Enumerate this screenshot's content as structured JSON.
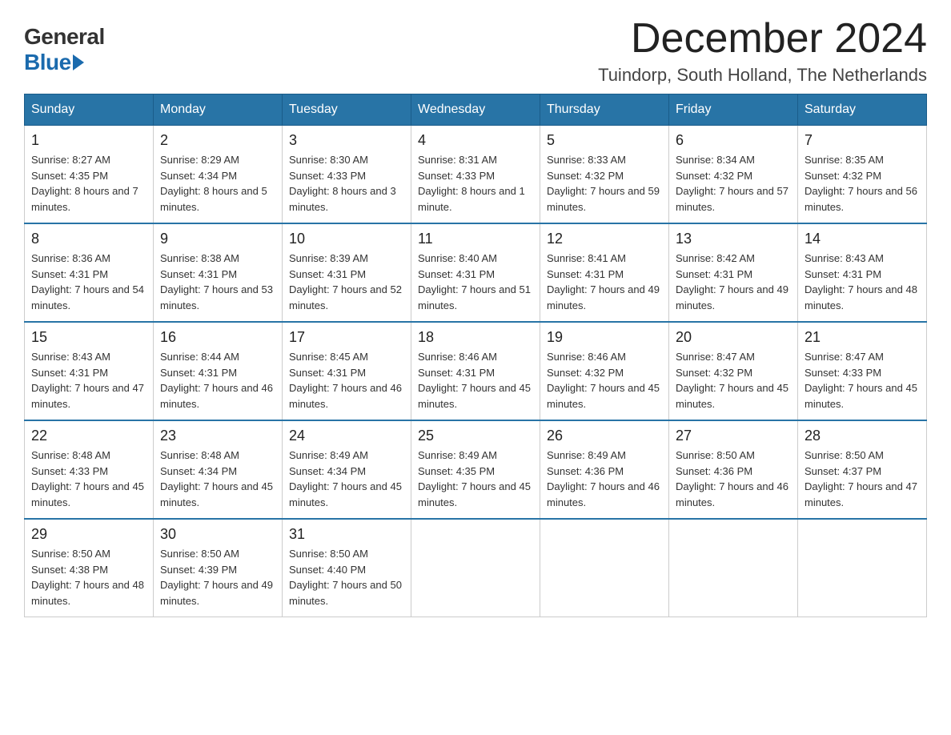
{
  "logo": {
    "general": "General",
    "blue": "Blue"
  },
  "header": {
    "month_year": "December 2024",
    "location": "Tuindorp, South Holland, The Netherlands"
  },
  "weekdays": [
    "Sunday",
    "Monday",
    "Tuesday",
    "Wednesday",
    "Thursday",
    "Friday",
    "Saturday"
  ],
  "weeks": [
    [
      {
        "day": "1",
        "sunrise": "8:27 AM",
        "sunset": "4:35 PM",
        "daylight": "8 hours and 7 minutes."
      },
      {
        "day": "2",
        "sunrise": "8:29 AM",
        "sunset": "4:34 PM",
        "daylight": "8 hours and 5 minutes."
      },
      {
        "day": "3",
        "sunrise": "8:30 AM",
        "sunset": "4:33 PM",
        "daylight": "8 hours and 3 minutes."
      },
      {
        "day": "4",
        "sunrise": "8:31 AM",
        "sunset": "4:33 PM",
        "daylight": "8 hours and 1 minute."
      },
      {
        "day": "5",
        "sunrise": "8:33 AM",
        "sunset": "4:32 PM",
        "daylight": "7 hours and 59 minutes."
      },
      {
        "day": "6",
        "sunrise": "8:34 AM",
        "sunset": "4:32 PM",
        "daylight": "7 hours and 57 minutes."
      },
      {
        "day": "7",
        "sunrise": "8:35 AM",
        "sunset": "4:32 PM",
        "daylight": "7 hours and 56 minutes."
      }
    ],
    [
      {
        "day": "8",
        "sunrise": "8:36 AM",
        "sunset": "4:31 PM",
        "daylight": "7 hours and 54 minutes."
      },
      {
        "day": "9",
        "sunrise": "8:38 AM",
        "sunset": "4:31 PM",
        "daylight": "7 hours and 53 minutes."
      },
      {
        "day": "10",
        "sunrise": "8:39 AM",
        "sunset": "4:31 PM",
        "daylight": "7 hours and 52 minutes."
      },
      {
        "day": "11",
        "sunrise": "8:40 AM",
        "sunset": "4:31 PM",
        "daylight": "7 hours and 51 minutes."
      },
      {
        "day": "12",
        "sunrise": "8:41 AM",
        "sunset": "4:31 PM",
        "daylight": "7 hours and 49 minutes."
      },
      {
        "day": "13",
        "sunrise": "8:42 AM",
        "sunset": "4:31 PM",
        "daylight": "7 hours and 49 minutes."
      },
      {
        "day": "14",
        "sunrise": "8:43 AM",
        "sunset": "4:31 PM",
        "daylight": "7 hours and 48 minutes."
      }
    ],
    [
      {
        "day": "15",
        "sunrise": "8:43 AM",
        "sunset": "4:31 PM",
        "daylight": "7 hours and 47 minutes."
      },
      {
        "day": "16",
        "sunrise": "8:44 AM",
        "sunset": "4:31 PM",
        "daylight": "7 hours and 46 minutes."
      },
      {
        "day": "17",
        "sunrise": "8:45 AM",
        "sunset": "4:31 PM",
        "daylight": "7 hours and 46 minutes."
      },
      {
        "day": "18",
        "sunrise": "8:46 AM",
        "sunset": "4:31 PM",
        "daylight": "7 hours and 45 minutes."
      },
      {
        "day": "19",
        "sunrise": "8:46 AM",
        "sunset": "4:32 PM",
        "daylight": "7 hours and 45 minutes."
      },
      {
        "day": "20",
        "sunrise": "8:47 AM",
        "sunset": "4:32 PM",
        "daylight": "7 hours and 45 minutes."
      },
      {
        "day": "21",
        "sunrise": "8:47 AM",
        "sunset": "4:33 PM",
        "daylight": "7 hours and 45 minutes."
      }
    ],
    [
      {
        "day": "22",
        "sunrise": "8:48 AM",
        "sunset": "4:33 PM",
        "daylight": "7 hours and 45 minutes."
      },
      {
        "day": "23",
        "sunrise": "8:48 AM",
        "sunset": "4:34 PM",
        "daylight": "7 hours and 45 minutes."
      },
      {
        "day": "24",
        "sunrise": "8:49 AM",
        "sunset": "4:34 PM",
        "daylight": "7 hours and 45 minutes."
      },
      {
        "day": "25",
        "sunrise": "8:49 AM",
        "sunset": "4:35 PM",
        "daylight": "7 hours and 45 minutes."
      },
      {
        "day": "26",
        "sunrise": "8:49 AM",
        "sunset": "4:36 PM",
        "daylight": "7 hours and 46 minutes."
      },
      {
        "day": "27",
        "sunrise": "8:50 AM",
        "sunset": "4:36 PM",
        "daylight": "7 hours and 46 minutes."
      },
      {
        "day": "28",
        "sunrise": "8:50 AM",
        "sunset": "4:37 PM",
        "daylight": "7 hours and 47 minutes."
      }
    ],
    [
      {
        "day": "29",
        "sunrise": "8:50 AM",
        "sunset": "4:38 PM",
        "daylight": "7 hours and 48 minutes."
      },
      {
        "day": "30",
        "sunrise": "8:50 AM",
        "sunset": "4:39 PM",
        "daylight": "7 hours and 49 minutes."
      },
      {
        "day": "31",
        "sunrise": "8:50 AM",
        "sunset": "4:40 PM",
        "daylight": "7 hours and 50 minutes."
      },
      null,
      null,
      null,
      null
    ]
  ]
}
